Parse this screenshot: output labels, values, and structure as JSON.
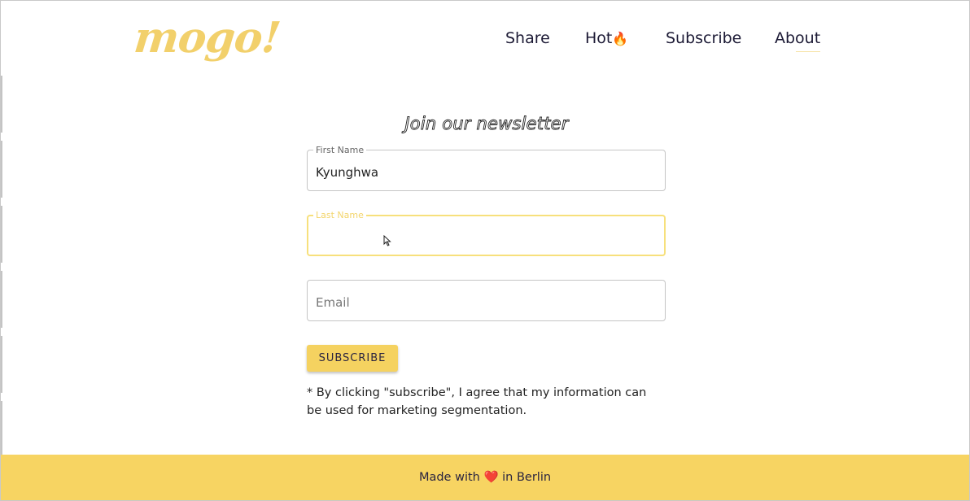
{
  "logo": {
    "text": "mogo!"
  },
  "nav": {
    "items": [
      {
        "label": "Share"
      },
      {
        "label": "Hot",
        "emoji": "🔥"
      },
      {
        "label": "Subscribe"
      },
      {
        "label": "About"
      }
    ]
  },
  "newsletter": {
    "title": "Join our newsletter",
    "first_name": {
      "label": "First Name",
      "value": "Kyunghwa"
    },
    "last_name": {
      "label": "Last Name",
      "value": ""
    },
    "email": {
      "placeholder": "Email",
      "value": ""
    },
    "subscribe_label": "SUBSCRIBE",
    "disclaimer": "* By clicking \"subscribe\", I agree that my information can be used for marketing segmentation."
  },
  "footer": {
    "prefix": "Made with",
    "heart": "❤️",
    "suffix": " in Berlin"
  },
  "colors": {
    "accent": "#f5d260",
    "focus_border": "#f7e07c",
    "text": "#1f1d33"
  },
  "icons": {
    "fire": "fire-icon",
    "heart": "heart-icon",
    "cursor": "mouse-cursor-icon"
  }
}
